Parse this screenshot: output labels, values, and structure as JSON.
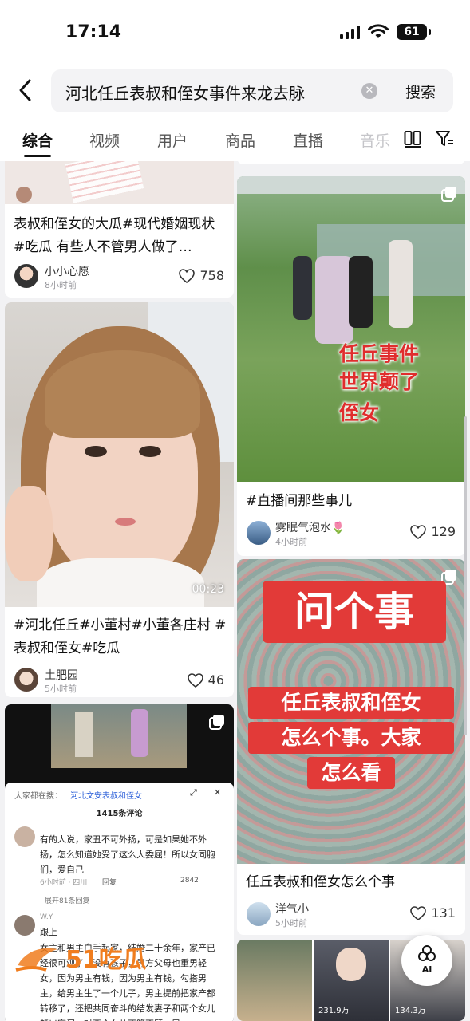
{
  "status_bar": {
    "time": "17:14",
    "battery": "61"
  },
  "search": {
    "query": "河北任丘表叔和侄女事件来龙去脉",
    "clear": "✕",
    "button": "搜索"
  },
  "tabs": [
    {
      "label": "综合"
    },
    {
      "label": "视频"
    },
    {
      "label": "用户"
    },
    {
      "label": "商品"
    },
    {
      "label": "直播"
    },
    {
      "label": "音乐"
    }
  ],
  "cards": {
    "post1": {
      "title": "表叔和侄女的大瓜#现代婚姻现状 #吃瓜 有些人不管男人做了…",
      "author": "小小心愿",
      "time": "8小时前",
      "likes": "758"
    },
    "post2": {
      "title": "#河北任丘#小董村#小董各庄村 #表叔和侄女#吃瓜",
      "author": "土肥园",
      "time": "5小时前",
      "likes": "46",
      "duration": "00:23"
    },
    "post3": {
      "hot_search_label": "大家都在搜：",
      "hot_search_term": "河北文安表叔和侄女",
      "comment_count": "1415条评论",
      "comment1_text": "有的人说，家丑不可外扬，可是如果她不外扬，怎么知道她受了这么大委屈！所以女同胞们，爱自己",
      "comment1_time": "6小时前 · 四川",
      "reply": "回复",
      "comment1_likes": "2842",
      "expand": "展开81条回复",
      "comment2_user": "W.Y",
      "comment2_text": "跟上",
      "comment3_text": "女主和男主白手起家，结婚二十余年，家产已经很可观了，没有孩子，男方父母也重男轻女，因为男主有钱，因为男主有钱，勾搭男主，给男主生了一个儿子，男主提前把家产都转移了，还把共同奋斗的结发妻子和两个女儿赶出家门，对两个女儿不管不顾，男"
    },
    "post4": {
      "overlay_lines": [
        "任丘事件",
        "世界颠了",
        "侄女"
      ],
      "title": "#直播间那些事儿",
      "author": "雾眠气泡水🌷",
      "time": "4小时前",
      "likes": "129"
    },
    "post5": {
      "stamp": "问个事",
      "question_lines": [
        "任丘表叔和侄女",
        "怎么个事。大家",
        "怎么看"
      ],
      "title": "任丘表叔和侄女怎么个事",
      "author": "洋气小",
      "time": "5小时前",
      "likes": "131"
    },
    "post6": {
      "view1": "231.9万",
      "view2": "134.3万"
    }
  },
  "watermark": "51吃瓜",
  "ai_button": "AI",
  "icons": [
    "back-arrow-icon",
    "clear-icon",
    "layout-toggle-icon",
    "filter-icon",
    "heart-icon",
    "multi-image-icon",
    "ai-icon",
    "signal-icon",
    "wifi-icon",
    "battery-icon"
  ],
  "colors": {
    "accent_red": "#e23a38",
    "overlay_red": "#e02d2d",
    "watermark_orange": "#f07d1e",
    "link_blue": "#2b5fd9"
  }
}
